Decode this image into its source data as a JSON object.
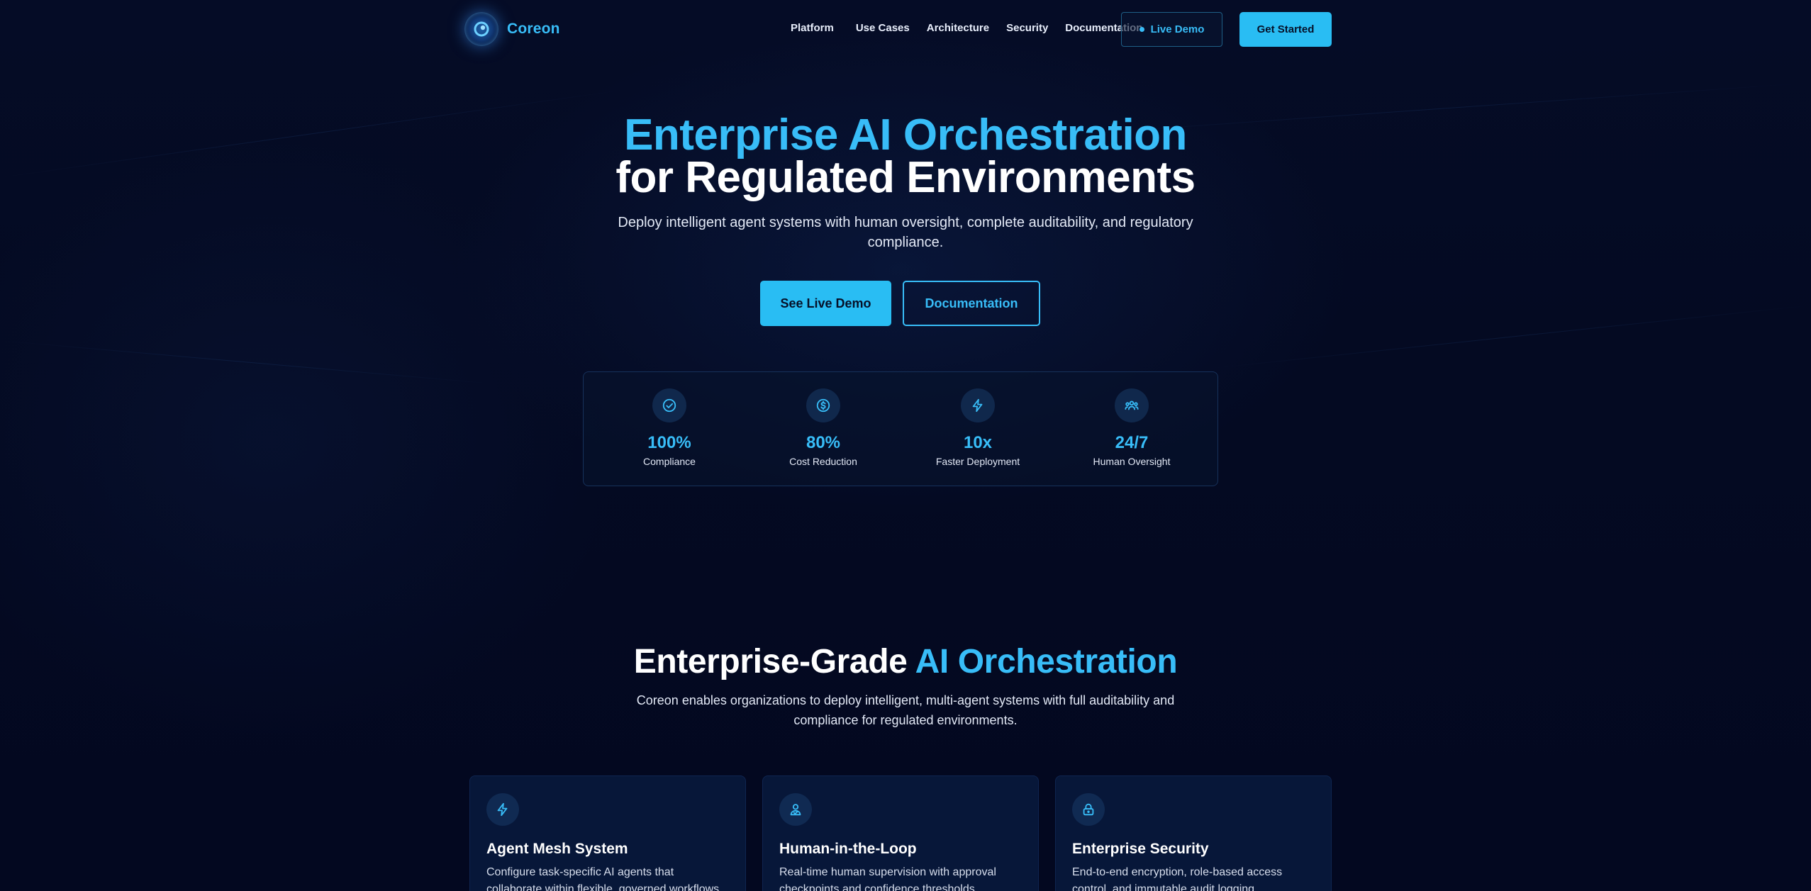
{
  "brand": {
    "name": "Coreon"
  },
  "nav": {
    "links": [
      "Platform",
      "Use Cases",
      "Architecture",
      "Security",
      "Documentation"
    ],
    "live_demo": "Live Demo",
    "get_started": "Get Started"
  },
  "hero": {
    "title_line1": "Enterprise AI Orchestration",
    "title_line2": "for Regulated Environments",
    "subtitle": "Deploy intelligent agent systems with human oversight, complete auditability, and regulatory compliance.",
    "primary_cta": "See Live Demo",
    "secondary_cta": "Documentation"
  },
  "stats": [
    {
      "icon": "check-circle-icon",
      "value": "100%",
      "label": "Compliance"
    },
    {
      "icon": "dollar-circle-icon",
      "value": "80%",
      "label": "Cost Reduction"
    },
    {
      "icon": "lightning-icon",
      "value": "10x",
      "label": "Faster Deployment"
    },
    {
      "icon": "users-icon",
      "value": "24/7",
      "label": "Human Oversight"
    }
  ],
  "section": {
    "title_white": "Enterprise-Grade ",
    "title_blue": "AI Orchestration",
    "subtitle": "Coreon enables organizations to deploy intelligent, multi-agent systems with full auditability and compliance for regulated environments."
  },
  "features": [
    {
      "icon": "lightning-icon",
      "title": "Agent Mesh System",
      "desc": "Configure task-specific AI agents that collaborate within flexible, governed workflows."
    },
    {
      "icon": "user-check-icon",
      "title": "Human-in-the-Loop",
      "desc": "Real-time human supervision with approval checkpoints and confidence thresholds."
    },
    {
      "icon": "lock-icon",
      "title": "Enterprise Security",
      "desc": "End-to-end encryption, role-based access control, and immutable audit logging."
    }
  ],
  "colors": {
    "background": "#03091f",
    "accent": "#38bdf8",
    "button": "#29bdf3",
    "card": "#071739"
  }
}
